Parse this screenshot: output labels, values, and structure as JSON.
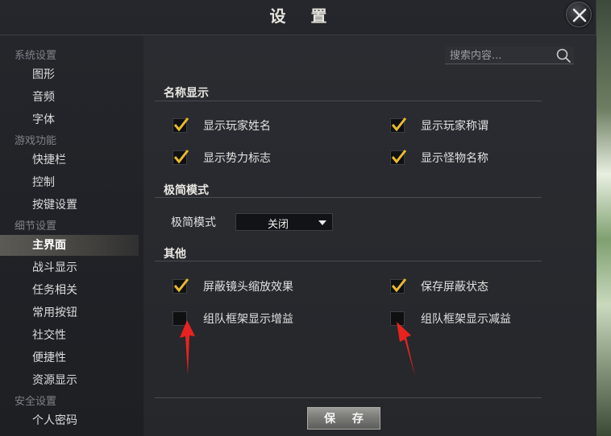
{
  "window": {
    "title": "设 置"
  },
  "search": {
    "placeholder": "搜索内容..."
  },
  "sidebar": {
    "categories": [
      "系统设置",
      "游戏功能",
      "细节设置",
      "安全设置"
    ],
    "items": [
      "图形",
      "音频",
      "字体",
      "快捷栏",
      "控制",
      "按键设置",
      "主界面",
      "战斗显示",
      "任务相关",
      "常用按钮",
      "社交性",
      "便捷性",
      "资源显示",
      "个人密码"
    ],
    "active": "主界面"
  },
  "sections": {
    "name_display": {
      "title": "名称显示",
      "options": [
        {
          "label": "显示玩家姓名",
          "checked": true
        },
        {
          "label": "显示玩家称谓",
          "checked": true
        },
        {
          "label": "显示势力标志",
          "checked": true
        },
        {
          "label": "显示怪物名称",
          "checked": true
        }
      ]
    },
    "minimal_mode": {
      "title": "极简模式",
      "label": "极简模式",
      "value": "关闭"
    },
    "other": {
      "title": "其他",
      "options": [
        {
          "label": "屏蔽镜头缩放效果",
          "checked": true
        },
        {
          "label": "保存屏蔽状态",
          "checked": true
        },
        {
          "label": "组队框架显示增益",
          "checked": false
        },
        {
          "label": "组队框架显示减益",
          "checked": false
        }
      ]
    }
  },
  "footer": {
    "save_label": "保 存"
  },
  "colors": {
    "check": "#e8b92f",
    "annotation_arrow": "#e8231f"
  }
}
